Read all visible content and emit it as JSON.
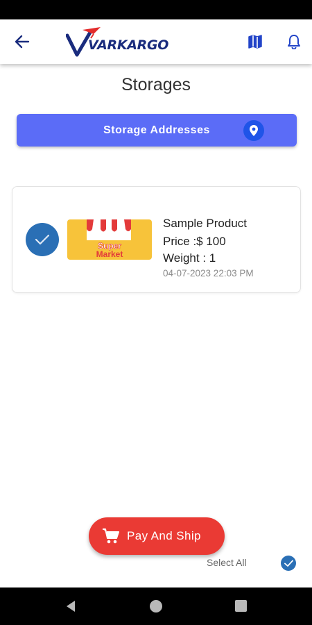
{
  "header": {
    "logo_text": "VARKARGO",
    "icons": {
      "back": "arrow-back-icon",
      "map": "map-icon",
      "notifications": "bell-icon"
    }
  },
  "page": {
    "title": "Storages"
  },
  "storage_button": {
    "label": "Storage Addresses",
    "icon": "location-pin-icon"
  },
  "product": {
    "name": "Sample Product",
    "price": "Price :$ 100",
    "weight": "Weight : 1",
    "date": "04-07-2023 22:03 PM",
    "image_text_line1": "Super",
    "image_text_line2": "Market",
    "selected": true
  },
  "footer": {
    "pay_label": "Pay And Ship",
    "select_all_label": "Select All",
    "select_all_checked": true
  },
  "colors": {
    "primary_blue": "#5b6cf7",
    "pin_blue": "#1f54e8",
    "check_blue": "#2a6fb5",
    "pay_red": "#ea3a34",
    "logo_navy": "#1a2c7e",
    "logo_red": "#e32b2b",
    "image_yellow": "#f7c33a"
  }
}
